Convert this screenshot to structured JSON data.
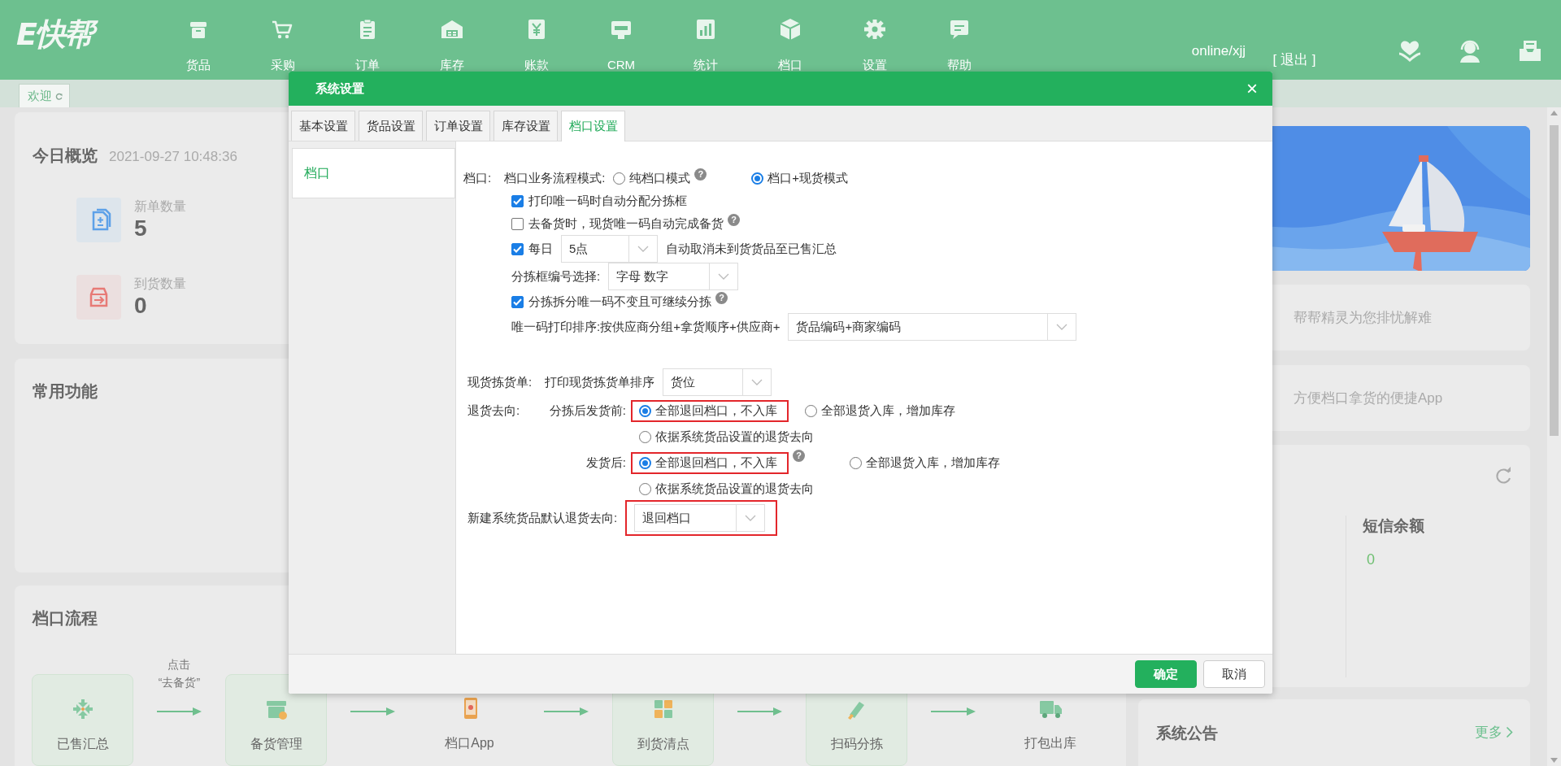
{
  "header": {
    "logo": "E快帮",
    "nav": [
      {
        "label": "货品"
      },
      {
        "label": "采购"
      },
      {
        "label": "订单"
      },
      {
        "label": "库存"
      },
      {
        "label": "账款"
      },
      {
        "label": "CRM"
      },
      {
        "label": "统计"
      },
      {
        "label": "档口"
      },
      {
        "label": "设置"
      },
      {
        "label": "帮助"
      }
    ],
    "user": "online/xjj",
    "logout": "[ 退出 ]"
  },
  "page_tabs": [
    {
      "label": "欢迎",
      "selected": true
    }
  ],
  "overview": {
    "title": "今日概览",
    "time": "2021-09-27 10:48:36",
    "stats": [
      {
        "kind": "orders",
        "label": "新单数量",
        "value": "5"
      },
      {
        "kind": "arrivals",
        "label": "到货数量",
        "value": "0"
      }
    ]
  },
  "common": {
    "title": "常用功能"
  },
  "flow": {
    "title": "档口流程",
    "hint": [
      "点击",
      "“去备货”"
    ],
    "steps": [
      {
        "label": "已售汇总",
        "kind": "card"
      },
      {
        "label": "备货管理",
        "kind": "card"
      },
      {
        "label": "档口App",
        "kind": "plain"
      },
      {
        "label": "到货清点",
        "kind": "card"
      },
      {
        "label": "扫码分拣",
        "kind": "card"
      },
      {
        "label": "打包出库",
        "kind": "plain"
      }
    ]
  },
  "sidebar": {
    "promos": [
      {
        "text": "帮帮精灵为您排忧解难"
      },
      {
        "text": "方便档口拿货的便捷App"
      }
    ],
    "sms": {
      "title": "短信余额",
      "value": "0"
    },
    "notice": {
      "title": "系统公告",
      "more": "更多"
    }
  },
  "dialog": {
    "title": "系统设置",
    "close": "×",
    "tabs": [
      {
        "label": "基本设置",
        "selected": false
      },
      {
        "label": "货品设置",
        "selected": false
      },
      {
        "label": "订单设置",
        "selected": false
      },
      {
        "label": "库存设置",
        "selected": false
      },
      {
        "label": "档口设置",
        "selected": true
      }
    ],
    "side_nav": [
      {
        "label": "档口",
        "selected": true
      }
    ],
    "sections": [
      {
        "rows": [
          {
            "kind": "field",
            "label": "档口:",
            "parts": [
              {
                "kind": "text",
                "text": "档口业务流程模式:"
              },
              {
                "kind": "radio",
                "text": "纯档口模式",
                "selected": false
              },
              {
                "kind": "help",
                "text": "?"
              },
              {
                "kind": "radio",
                "text": "档口+现货模式",
                "selected": true
              }
            ]
          },
          {
            "kind": "indent",
            "parts": [
              {
                "kind": "checkbox",
                "text": "打印唯一码时自动分配分拣框",
                "checked": true
              }
            ]
          },
          {
            "kind": "indent",
            "parts": [
              {
                "kind": "checkbox",
                "text": "去备货时，现货唯一码自动完成备货",
                "checked": false
              },
              {
                "kind": "help",
                "text": "?"
              }
            ]
          },
          {
            "kind": "indent",
            "parts": [
              {
                "kind": "checkbox",
                "text": "每日",
                "checked": true
              },
              {
                "kind": "select",
                "value": "5点"
              },
              {
                "kind": "text",
                "text": "自动取消未到货货品至已售汇总"
              }
            ]
          },
          {
            "kind": "indent",
            "parts": [
              {
                "kind": "text",
                "text": "分拣框编号选择:"
              },
              {
                "kind": "select",
                "value": "字母 数字"
              }
            ]
          },
          {
            "kind": "indent",
            "parts": [
              {
                "kind": "checkbox",
                "text": "分拣拆分唯一码不变且可继续分拣",
                "checked": true
              },
              {
                "kind": "help",
                "text": "?"
              }
            ]
          },
          {
            "kind": "indent",
            "parts": [
              {
                "kind": "text",
                "text": "唯一码打印排序:按供应商分组+拿货顺序+供应商+"
              },
              {
                "kind": "select",
                "value": "货品编码+商家编码"
              }
            ]
          }
        ]
      },
      {
        "rows": [
          {
            "kind": "field",
            "label": "现货拣货单:",
            "parts": [
              {
                "kind": "text",
                "text": "打印现货拣货单排序"
              },
              {
                "kind": "select",
                "value": "货位"
              }
            ]
          },
          {
            "kind": "split",
            "label": "退货去向:",
            "sublabel": "分拣后发货前:",
            "parts": [
              {
                "kind": "radio",
                "text": "全部退回档口，不入库",
                "selected": true,
                "framed": true
              },
              {
                "kind": "radio",
                "text": "全部退货入库，增加库存",
                "selected": false
              }
            ]
          },
          {
            "kind": "option",
            "parts": [
              {
                "kind": "radio",
                "text": "依据系统货品设置的退货去向",
                "selected": false
              }
            ]
          },
          {
            "kind": "split",
            "sublabel": "发货后:",
            "parts": [
              {
                "kind": "radio",
                "text": "全部退回档口，不入库",
                "selected": true,
                "framed": true
              },
              {
                "kind": "help",
                "text": "?"
              },
              {
                "kind": "radio",
                "text": "全部退货入库，增加库存",
                "selected": false
              }
            ]
          },
          {
            "kind": "option",
            "parts": [
              {
                "kind": "radio",
                "text": "依据系统货品设置的退货去向",
                "selected": false
              }
            ]
          },
          {
            "kind": "field",
            "label": "新建系统货品默认退货去向:",
            "parts": [
              {
                "kind": "select",
                "value": "退回档口",
                "framed": true
              }
            ]
          }
        ]
      }
    ],
    "buttons": [
      {
        "label": "确定",
        "kind": "primary"
      },
      {
        "label": "取消",
        "kind": "secondary"
      }
    ]
  }
}
